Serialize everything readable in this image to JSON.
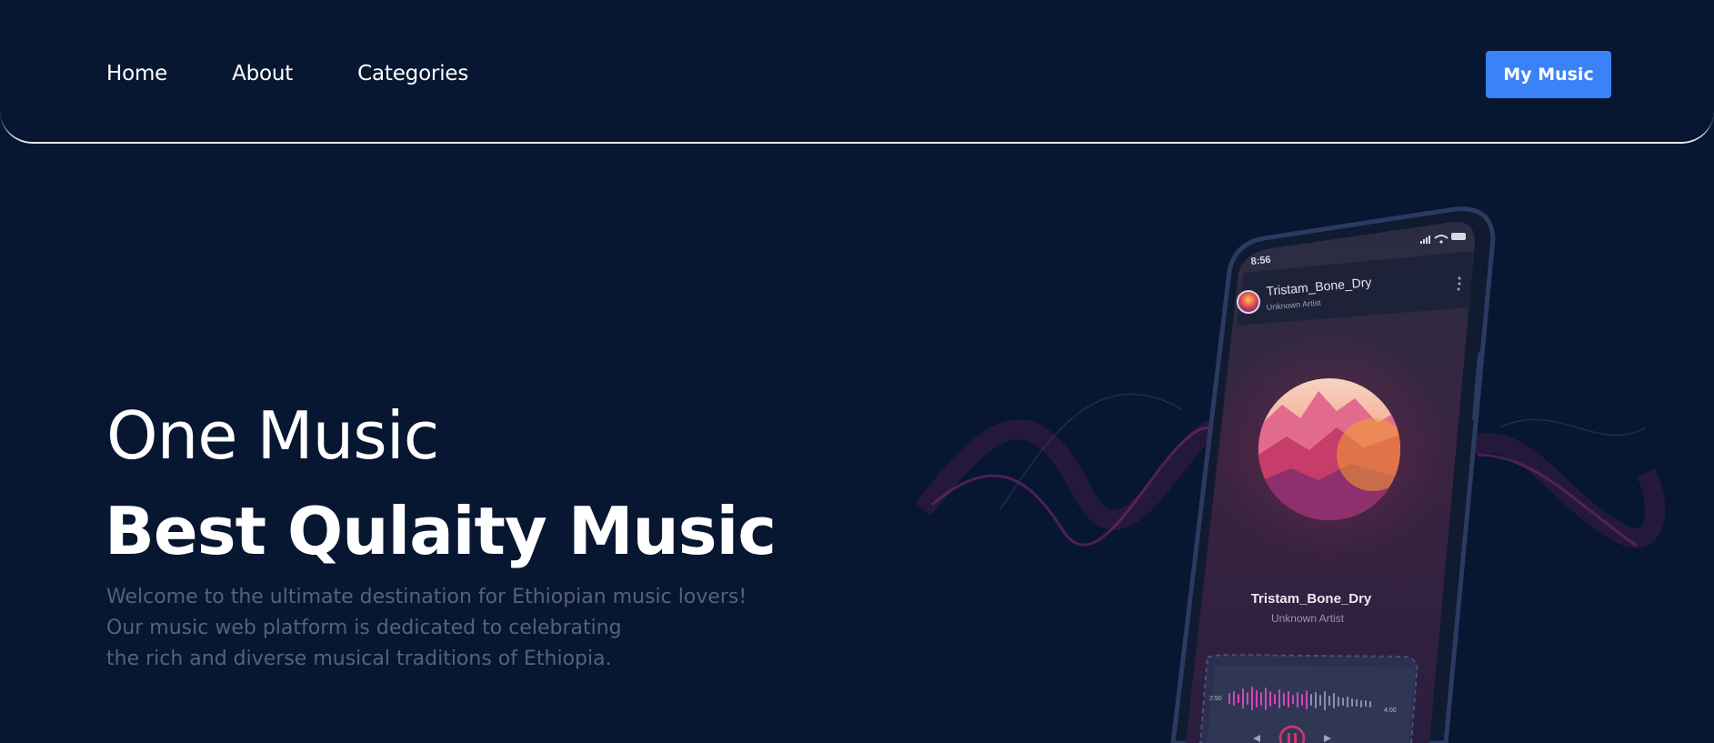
{
  "nav": {
    "items": [
      {
        "label": "Home"
      },
      {
        "label": "About"
      },
      {
        "label": "Categories"
      }
    ],
    "cta_label": "My Music"
  },
  "hero": {
    "title": "One Music",
    "heading": "Best Qulaity Music",
    "description_lines": [
      "Welcome to the ultimate destination for Ethiopian music lovers!",
      "Our music web platform is dedicated to celebrating",
      "the rich and diverse musical traditions of Ethiopia."
    ]
  },
  "phone": {
    "status_time": "8:56",
    "track_title": "Tristam_Bone_Dry",
    "track_artist": "Unknown Artist",
    "time_elapsed": "2:50",
    "time_total": "4:00"
  },
  "colors": {
    "background": "#071631",
    "accent_button": "#3b82f6",
    "description_text": "#56617a",
    "wave_accent": "#b0309a"
  },
  "icons": [
    "signal-icon",
    "wifi-icon",
    "battery-icon",
    "more-vertical-icon",
    "pause-icon",
    "previous-icon",
    "next-icon"
  ]
}
